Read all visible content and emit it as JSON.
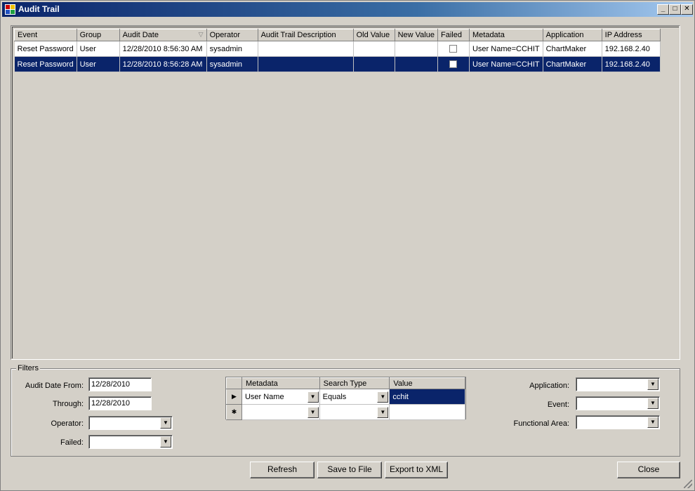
{
  "window": {
    "title": "Audit Trail",
    "minimize": "_",
    "maximize": "□",
    "close": "✕"
  },
  "grid": {
    "columns": [
      "Event",
      "Group",
      "Audit Date",
      "Operator",
      "Audit Trail Description",
      "Old Value",
      "New Value",
      "Failed",
      "Metadata",
      "Application",
      "IP Address"
    ],
    "sort_indicator": "▽",
    "rows": [
      {
        "event": "Reset Password",
        "group": "User",
        "date": "12/28/2010 8:56:30 AM",
        "operator": "sysadmin",
        "description": "",
        "old": "",
        "new": "",
        "failed": false,
        "metadata": "User Name=CCHIT",
        "application": "ChartMaker",
        "ip": "192.168.2.40"
      },
      {
        "event": "Reset Password",
        "group": "User",
        "date": "12/28/2010 8:56:28 AM",
        "operator": "sysadmin",
        "description": "",
        "old": "",
        "new": "",
        "failed": false,
        "metadata": "User Name=CCHIT",
        "application": "ChartMaker",
        "ip": "192.168.2.40"
      }
    ]
  },
  "filters": {
    "legend": "Filters",
    "audit_date_from_label": "Audit Date From:",
    "audit_date_from_value": "12/28/2010",
    "through_label": "Through:",
    "through_value": "12/28/2010",
    "operator_label": "Operator:",
    "operator_value": "",
    "failed_label": "Failed:",
    "failed_value": "",
    "application_label": "Application:",
    "application_value": "",
    "event_label": "Event:",
    "event_value": "",
    "functional_area_label": "Functional Area:",
    "functional_area_value": "",
    "metadata_grid": {
      "columns": [
        "Metadata",
        "Search Type",
        "Value"
      ],
      "current_row_marker": "▶",
      "new_row_marker": "✱",
      "rows": [
        {
          "metadata": "User Name",
          "search_type": "Equals",
          "value": "cchit"
        },
        {
          "metadata": "",
          "search_type": "",
          "value": ""
        }
      ]
    }
  },
  "buttons": {
    "refresh": "Refresh",
    "save_to_file": "Save to File",
    "export_xml": "Export to XML",
    "close": "Close"
  },
  "dropdown_glyph": "▼"
}
